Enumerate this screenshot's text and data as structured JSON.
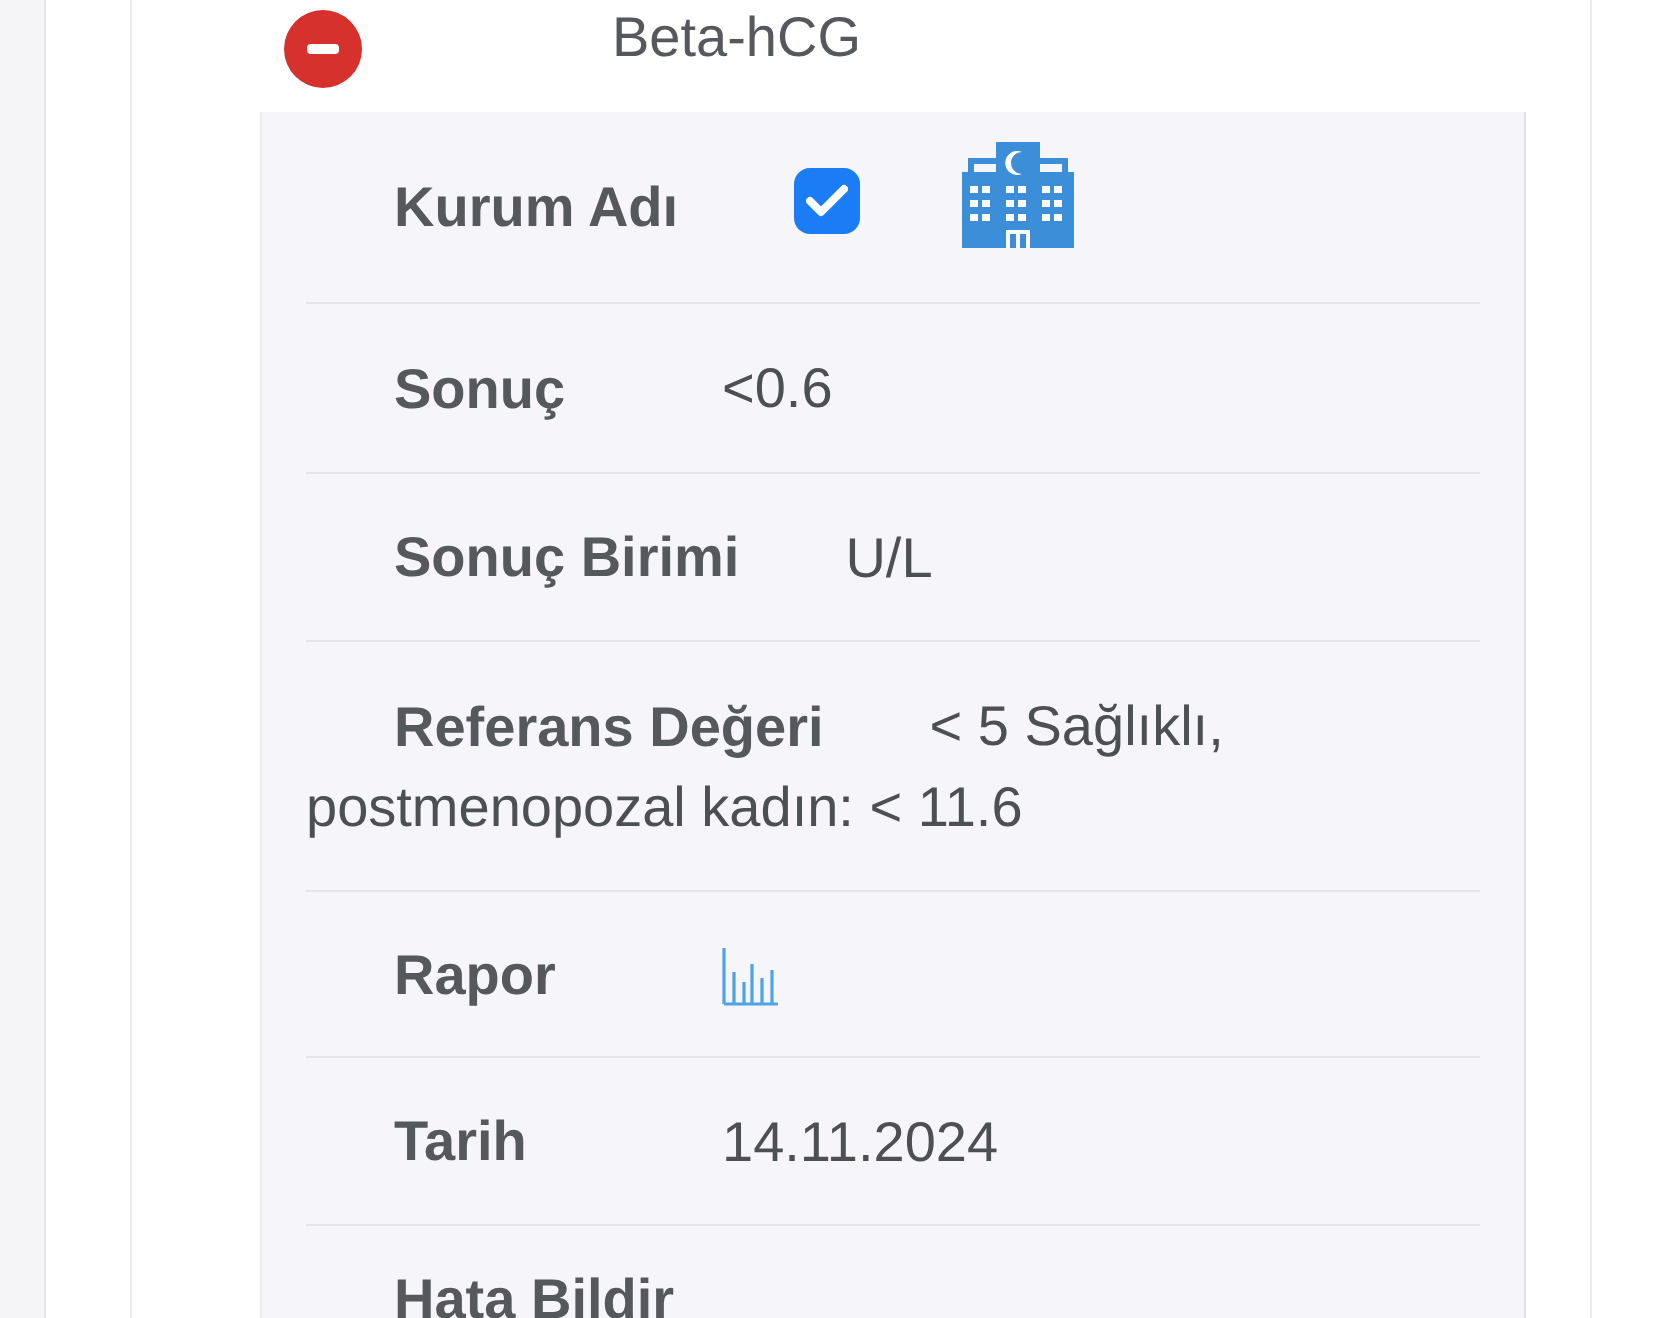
{
  "panel": {
    "expanded": true,
    "title": "Beta-hCG"
  },
  "fields": [
    {
      "kind": "institution",
      "label": "Kurum Adı",
      "checked": true
    },
    {
      "kind": "text",
      "label": "Sonuç",
      "value": "<0.6"
    },
    {
      "kind": "text",
      "label": "Sonuç Birimi",
      "value": "U/L"
    },
    {
      "kind": "lines",
      "label": "Referans Değeri",
      "lines": [
        "< 5 Sağlıklı,",
        "postmenopozal kadın: < 11.6"
      ]
    },
    {
      "kind": "report",
      "label": "Rapor"
    },
    {
      "kind": "text",
      "label": "Tarih",
      "value": "14.11.2024"
    },
    {
      "kind": "empty",
      "label": "Hata Bildir"
    }
  ]
}
